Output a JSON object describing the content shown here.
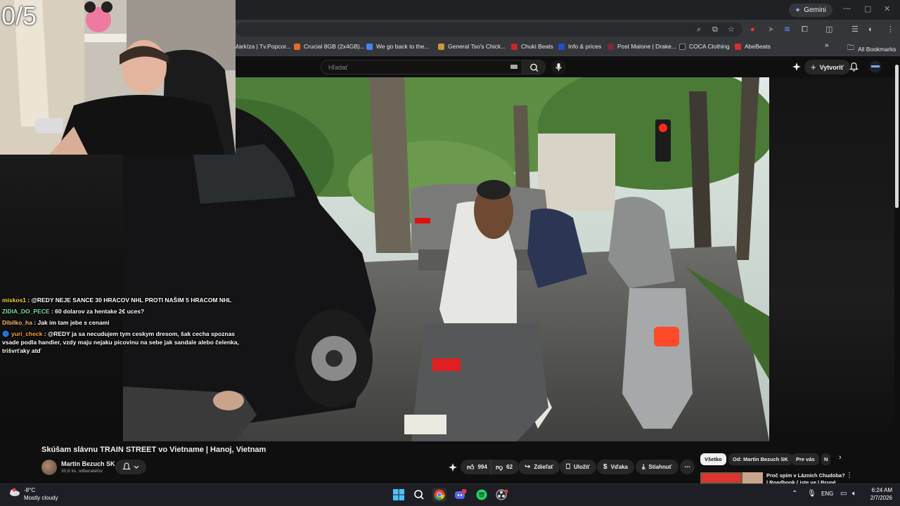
{
  "browser": {
    "gemini_label": "Gemini",
    "bookmarks": [
      {
        "label": "Markíza | Tv.Popcor...",
        "color": "#d34a3a"
      },
      {
        "label": "Crucial 8GB (2x4GB)...",
        "color": "#e8692b"
      },
      {
        "label": "We go back to the...",
        "color": "#4285f4"
      },
      {
        "label": "General Tso's Chick...",
        "color": "#c79a3b"
      },
      {
        "label": "Chuki Beats",
        "color": "#c62828"
      },
      {
        "label": "Info & prices",
        "color": "#1e50c8"
      },
      {
        "label": "Post Malone | Drake...",
        "color": "#7b2a3a"
      },
      {
        "label": "COCA Clothing",
        "color": "#222222"
      },
      {
        "label": "AbeBeats",
        "color": "#d32f2f"
      }
    ],
    "more_label": "»",
    "all_bookmarks": "All Bookmarks"
  },
  "youtube": {
    "search_placeholder": "Hľadať",
    "create_label": "Vytvoriť",
    "video_title": "Skúšam slávnu TRAIN STREET vo Vietname | Hanoj, Vietnam",
    "channel_name": "Martin Bezuch SK",
    "subscribers": "30,8 tis. odberateľov",
    "likes": "994",
    "dislikes": "62",
    "share_label": "Zdieľať",
    "save_label": "Uložiť",
    "thanks_label": "Vďaka",
    "download_label": "Stiahnuť",
    "chips": [
      "Všetko",
      "Od: Martin Bezuch SK",
      "Pre vás",
      "N"
    ],
    "rec_title": "Proč spím v Lázních Chudoba? | Roadbook ( jste ve | Bruné"
  },
  "overlay": {
    "counter": "0/5",
    "chat": [
      {
        "user": "miskos1",
        "user_color": "#ffd23f",
        "text": " : @REDY NEJE SANCE 30 HRACOV NHL PROTI NAŠIM 5 HRACOM NHL",
        "badge": ""
      },
      {
        "user": "ZIDIA_DO_PECE",
        "user_color": "#7ee0a0",
        "text": " : 60 dolarov za hentake 2€ uces?",
        "badge": ""
      },
      {
        "user": "Dibilko_ha",
        "user_color": "#ffb86b",
        "text": " : Jak im tam jebe s cenami",
        "badge": ""
      },
      {
        "user": "yuri_check",
        "user_color": "#ff9f43",
        "text": " : @REDY ja sa necudujem tym ceskym dresom, šak cecha spoznas vsade podla handier, vzdy maju nejaku picovinu na sebe jak sandale alebo čelenka, trišvrťaky atď",
        "badge": "🔵"
      }
    ]
  },
  "taskbar": {
    "temperature": "-8°C",
    "weather": "Mostly cloudy",
    "language": "ENG",
    "time": "6:24 AM",
    "date": "2/7/2026"
  },
  "colors": {
    "yt_bg": "#0f0f0f",
    "pill_bg": "#272727",
    "chrome_bg": "#35363a",
    "taskbar_bg": "#1e1f24"
  }
}
